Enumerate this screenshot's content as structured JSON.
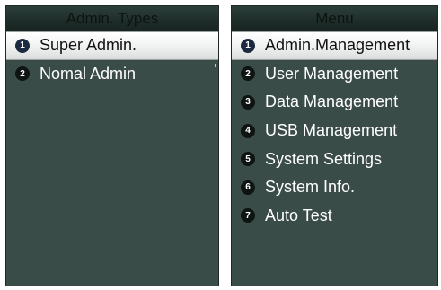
{
  "left_panel": {
    "title": "Admin. Types",
    "items": [
      {
        "num": "1",
        "label": "Super Admin."
      },
      {
        "num": "2",
        "label": "Nomal Admin"
      }
    ]
  },
  "right_panel": {
    "title": "Menu",
    "items": [
      {
        "num": "1",
        "label": "Admin.Management"
      },
      {
        "num": "2",
        "label": "User Management"
      },
      {
        "num": "3",
        "label": "Data Management"
      },
      {
        "num": "4",
        "label": "USB Management"
      },
      {
        "num": "5",
        "label": "System Settings"
      },
      {
        "num": "6",
        "label": "System Info."
      },
      {
        "num": "7",
        "label": "Auto Test"
      }
    ]
  }
}
